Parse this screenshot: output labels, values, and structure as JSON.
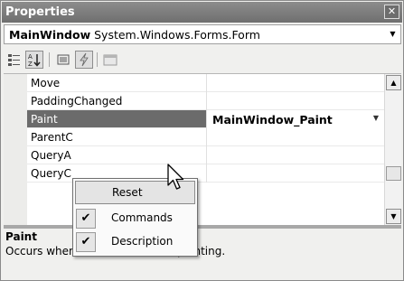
{
  "window": {
    "title": "Properties",
    "close_glyph": "✕"
  },
  "object_selector": {
    "name": "MainWindow",
    "type": "System.Windows.Forms.Form"
  },
  "toolbar": {
    "buttons": [
      {
        "icon": "categorized-icon"
      },
      {
        "icon": "alphabetical-icon",
        "checked": true
      },
      {
        "icon": "properties-icon"
      },
      {
        "icon": "events-icon",
        "checked": true
      },
      {
        "icon": "property-pages-icon"
      }
    ]
  },
  "grid": {
    "rows": [
      {
        "name": "Move",
        "value": ""
      },
      {
        "name": "PaddingChanged",
        "value": ""
      },
      {
        "name": "Paint",
        "value": "MainWindow_Paint",
        "selected": true
      },
      {
        "name": "ParentC",
        "value": ""
      },
      {
        "name": "QueryA",
        "value": ""
      },
      {
        "name": "QueryC",
        "value": ""
      }
    ]
  },
  "context_menu": {
    "items": [
      {
        "label": "Reset",
        "checked": false,
        "hover": true
      },
      {
        "label": "Commands",
        "checked": true
      },
      {
        "label": "Description",
        "checked": true
      }
    ]
  },
  "description": {
    "title": "Paint",
    "text": "Occurs when a control needs repainting."
  },
  "colors": {
    "titlebar": "#7a7a7a",
    "selection": "#6b6b6b",
    "panel": "#f0f0ee"
  }
}
